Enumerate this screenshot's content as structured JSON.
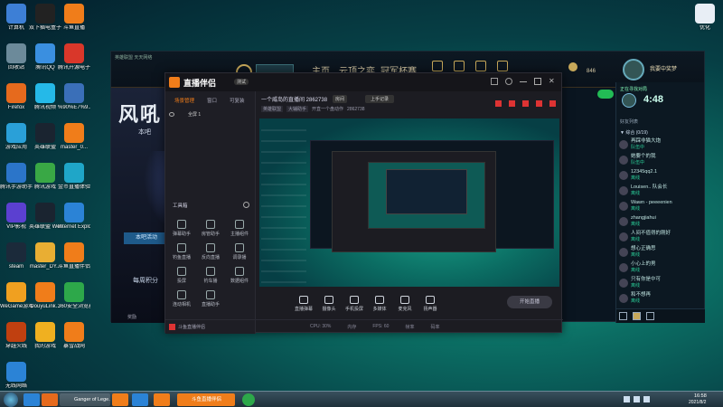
{
  "desktop": {
    "icons": [
      {
        "label": "计算机",
        "color": "#3d7fd6"
      },
      {
        "label": "双下插电盒子",
        "color": "#222"
      },
      {
        "label": "斗鱼直播",
        "color": "#f07d1a"
      },
      {
        "label": "回收站",
        "color": "#6c8a9a"
      },
      {
        "label": "腾讯QQ",
        "color": "#3a8fe0"
      },
      {
        "label": "腾讯开源电子",
        "color": "#d9372a"
      },
      {
        "label": "Firefox",
        "color": "#e66a1d"
      },
      {
        "label": "腾讯视频",
        "color": "#25b9e8"
      },
      {
        "label": "%90%E7%9...",
        "color": "#3a6fb8"
      },
      {
        "label": "游戏应用",
        "color": "#2aa0d8"
      },
      {
        "label": "英雄联盟",
        "color": "#1a2430"
      },
      {
        "label": "master_0...",
        "color": "#f07d1a"
      },
      {
        "label": "腾讯手游助手",
        "color": "#2b75c9"
      },
      {
        "label": "腾讯游戏",
        "color": "#39a845"
      },
      {
        "label": "金币直播体验",
        "color": "#1fa6c8"
      },
      {
        "label": "VIP影视",
        "color": "#5b40d0"
      },
      {
        "label": "英雄联盟 WeGame版",
        "color": "#1a2430"
      },
      {
        "label": "Internet Explorer",
        "color": "#2b83d6"
      },
      {
        "label": "steam",
        "color": "#1b2a3a"
      },
      {
        "label": "master_DY...",
        "color": "#e9ae33"
      },
      {
        "label": "斗鱼直播伴侣",
        "color": "#f07d1a"
      },
      {
        "label": "WeGame游戏",
        "color": "#f0a020"
      },
      {
        "label": "DouyuLink...",
        "color": "#f07d1a"
      },
      {
        "label": "360安全浏览器",
        "color": "#2da84a"
      },
      {
        "label": "穿越火线",
        "color": "#c04010"
      },
      {
        "label": "我的游戏",
        "color": "#f0b020"
      },
      {
        "label": "暴雪战网",
        "color": "#f07d1a"
      },
      {
        "label": "无线网络",
        "color": "#2b83d6"
      }
    ],
    "top_right_icon": {
      "label": "优化"
    }
  },
  "lol": {
    "logo_sub": "英雄联盟",
    "nav": [
      "主页",
      "云顶之弈",
      "冠军杯赛"
    ],
    "currency": "846",
    "player": "我要中奖梦",
    "banner_title": "风吼",
    "banner_text": "本吧",
    "btn_text": "本吧活动",
    "promo": "每周积分",
    "reward_label": "奖励",
    "timer_label": "正在寻找对局",
    "timer": "4:48",
    "friends_header": "好友列表",
    "group_label": "▼ 综合 (0/19)",
    "friends": [
      {
        "name": "再踩非猫大炮",
        "status": "队伍中"
      },
      {
        "name": "她要个的我",
        "status": "队伍中"
      },
      {
        "name": "12345qq2.1",
        "status": "离线"
      },
      {
        "name": "Louisen.. 队会长",
        "status": "离线"
      },
      {
        "name": "Wawn - peeeenien",
        "status": "离线"
      },
      {
        "name": "zhangjiahui",
        "status": "离线"
      },
      {
        "name": "人间不值得的刚好",
        "status": "离线"
      },
      {
        "name": "想心正确思",
        "status": "离线"
      },
      {
        "name": "小心上的男",
        "status": "离线"
      },
      {
        "name": "只有你是中可",
        "status": "离线"
      },
      {
        "name": "和不想再",
        "status": "离线"
      }
    ]
  },
  "broadcast": {
    "title": "直播伴侣",
    "title_badge": "测试",
    "room_text": "一个威岛的直播间 2862738",
    "room_badge": "房间",
    "share_btn": "上手记录",
    "sub_tag1": "英雄联盟",
    "sub_tag2": "大辅助手",
    "sub_text": "开直一个盘动作",
    "sub_num": "2862738",
    "tabs": [
      "场景管理",
      "窗口",
      "可复装"
    ],
    "scene": "全屏 1",
    "tool_header": "工具箱",
    "tools": [
      "弹幕助手",
      "房管助手",
      "主播组件",
      "钓鱼直播",
      "反向直播",
      "调录播",
      "投屏",
      "钓车播",
      "数据组件",
      "连动相机",
      "直播助手"
    ],
    "bottom_btns": [
      "直播弹幕",
      "摄像头",
      "手机投屏",
      "多媒体",
      "麦克风",
      "扬声器"
    ],
    "start_btn": "开始直播",
    "footer_text": "斗鱼直播伴侣",
    "status_bar": [
      "CPU: 30%",
      "内存",
      "FPS: 60",
      "帧率",
      "码率"
    ]
  },
  "taskbar": {
    "items": [
      "Ganger of Lege...",
      "",
      "",
      "斗鱼直播伴侣",
      ""
    ],
    "time": "16:58",
    "date": "2021/8/2"
  }
}
